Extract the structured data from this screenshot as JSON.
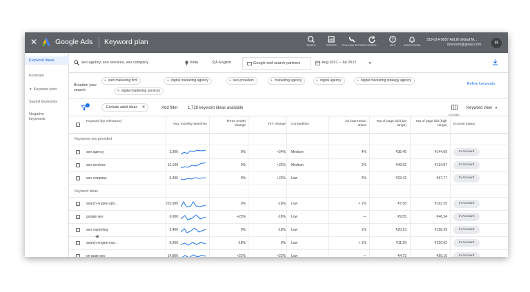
{
  "topbar": {
    "close": "✕",
    "brand": "Google Ads",
    "title": "Keyword plan",
    "tools": [
      {
        "label": "SEARCH",
        "icon": "search-icon"
      },
      {
        "label": "REPORTS",
        "icon": "reports-icon"
      },
      {
        "label": "TOOLS AND SETTINGS",
        "icon": "wrench-icon"
      },
      {
        "label": "REFRESH",
        "icon": "refresh-icon"
      },
      {
        "label": "HELP",
        "icon": "help-icon"
      },
      {
        "label": "NOTIFICATIONS",
        "icon": "bell-icon"
      }
    ],
    "account_id": "319-014-5057 AdLift Global M...",
    "account_email": "devroom@gmail.com",
    "avatar": "R"
  },
  "sidenav": {
    "items": [
      "Keyword ideas",
      "Forecast",
      "Keyword plan",
      "Saved keywords",
      "Negative keywords"
    ]
  },
  "filterbar": {
    "search_value": "seo agency, seo services, seo company",
    "location": "India",
    "language": "English",
    "network": "Google and search partners",
    "date_range": "Aug 2021 – Jul 2022"
  },
  "broaden": {
    "label": "Broaden your search:",
    "chips": [
      "web marketing firm",
      "digital marketing agency",
      "seo providers",
      "marketing agency",
      "digital agency",
      "digital marketing strategy agency",
      "digital marketing services"
    ],
    "refine": "Refine keywords"
  },
  "toolbar": {
    "filter_badge": "1",
    "exclude_chip": "Exclude adult ideas",
    "add_filter": "Add filter",
    "count": "1,728 keyword ideas available",
    "columns_label": "COLUMNS",
    "view": "Keyword view"
  },
  "table": {
    "headers": [
      "Keyword (by relevance)",
      "Avg. monthly searches",
      "Three month change",
      "YoY change",
      "Competition",
      "Ad impression share",
      "Top of page bid (low range)",
      "Top of page bid (high range)",
      "Account status"
    ],
    "group_provided": "Keywords you provided",
    "group_ideas": "Keyword ideas",
    "provided": [
      {
        "keyword": "seo agency",
        "searches": "2,900",
        "three_month": "0%",
        "yoy": "+24%",
        "competition": "Medium",
        "impr": "4%",
        "bid_low": "₹36.45",
        "bid_high": "₹144.09",
        "status": "In Account"
      },
      {
        "keyword": "seo services",
        "searches": "12,100",
        "three_month": "0%",
        "yoy": "+22%",
        "competition": "Medium",
        "impr": "2%",
        "bid_low": "₹43.52",
        "bid_high": "₹134.87",
        "status": "In Account"
      },
      {
        "keyword": "seo company",
        "searches": "5,400",
        "three_month": "0%",
        "yoy": "+22%",
        "competition": "Low",
        "impr": "2%",
        "bid_low": "₹23.42",
        "bid_high": "₹67.77",
        "status": "In Account"
      }
    ],
    "ideas": [
      {
        "keyword": "search engine opti...",
        "searches": "201,000",
        "three_month": "0%",
        "yoy": "-18%",
        "competition": "Low",
        "impr": "< 1%",
        "bid_low": "₹7.56",
        "bid_high": "₹163.25",
        "status": "In Account"
      },
      {
        "keyword": "google seo",
        "searches": "6,600",
        "three_month": "+23%",
        "yoy": "-18%",
        "competition": "Low",
        "impr": "—",
        "bid_low": "₹9.55",
        "bid_high": "₹46.34",
        "status": "In Account"
      },
      {
        "keyword": "seo marketing",
        "searches": "5,400",
        "three_month": "0%",
        "yoy": "-18%",
        "competition": "Low",
        "impr": "1%",
        "bid_low": "₹20.13",
        "bid_high": "₹158.29",
        "status": "In Account"
      },
      {
        "keyword": "search engine mar...",
        "searches": "9,900",
        "three_month": "-18%",
        "yoy": "0%",
        "competition": "Low",
        "impr": "< 1%",
        "bid_low": "₹11.29",
        "bid_high": "₹220.62",
        "status": "In Account"
      },
      {
        "keyword": "on page seo",
        "searches": "14,800",
        "three_month": "+22%",
        "yoy": "+22%",
        "competition": "Low",
        "impr": "—",
        "bid_low": "₹4.73",
        "bid_high": "₹99.16",
        "status": "In Account"
      }
    ]
  },
  "colors": {
    "accent": "#1a73e8",
    "topbar": "#5f6368",
    "nav_active_bg": "#e8f0fe"
  }
}
